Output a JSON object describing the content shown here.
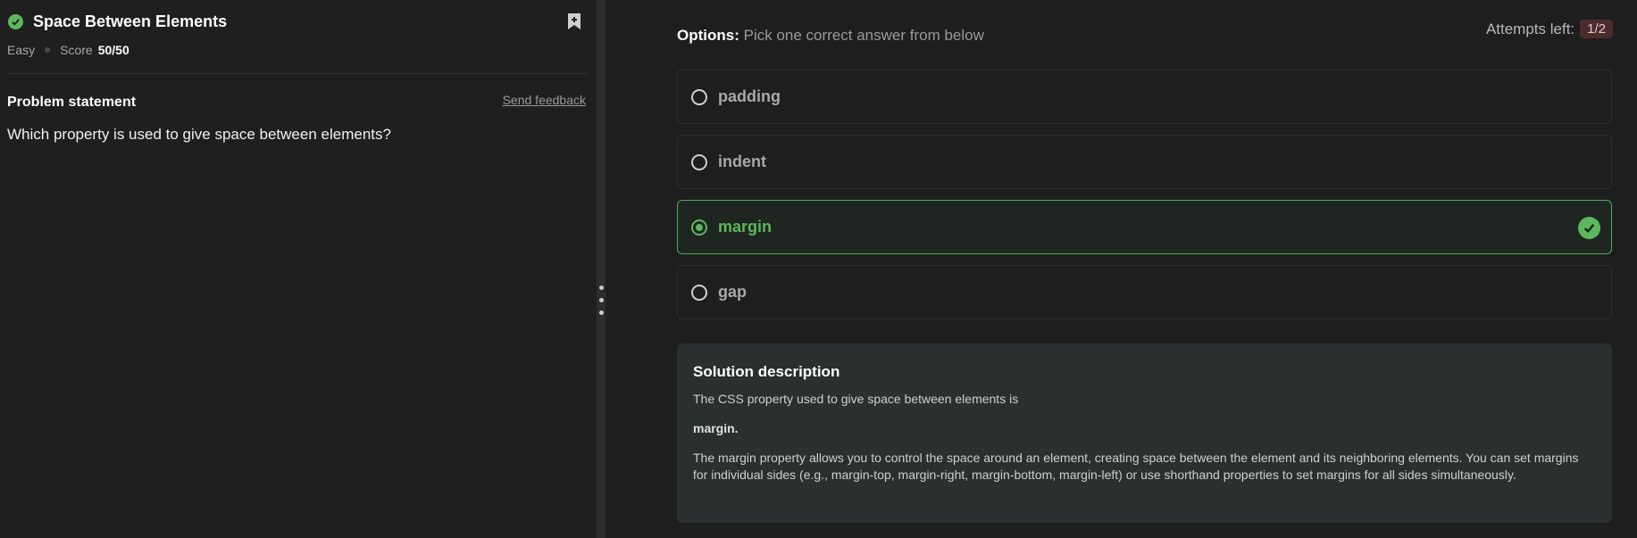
{
  "problem": {
    "title": "Space Between Elements",
    "difficulty": "Easy",
    "score_label": "Score",
    "score_value": "50/50",
    "statement_label": "Problem statement",
    "feedback_link": "Send feedback",
    "question": "Which property is used to give space between elements?"
  },
  "options_section": {
    "heading": "Options:",
    "hint": "Pick one correct answer from below",
    "attempts_label": "Attempts left:",
    "attempts_value": "1/2",
    "options": [
      {
        "label": "padding",
        "state": "unselected"
      },
      {
        "label": "indent",
        "state": "unselected"
      },
      {
        "label": "margin",
        "state": "correct"
      },
      {
        "label": "gap",
        "state": "unselected"
      }
    ]
  },
  "solution": {
    "title": "Solution description",
    "intro": "The CSS property used to give space between elements is",
    "answer": "margin.",
    "explanation": "The margin property allows you to control the space around an element, creating space between the element and its neighboring elements. You can set margins for individual sides (e.g., margin-top, margin-right, margin-bottom, margin-left) or use shorthand properties to set margins for all sides simultaneously."
  },
  "colors": {
    "success": "#5cb85c",
    "panel_bg": "#1f1f1f",
    "solution_bg": "#29302f",
    "attempts_badge_bg": "#4a2c2c"
  },
  "icons": {
    "solved": "check-circle-icon",
    "bookmark": "bookmark-plus-icon",
    "correct": "check-circle-icon"
  }
}
